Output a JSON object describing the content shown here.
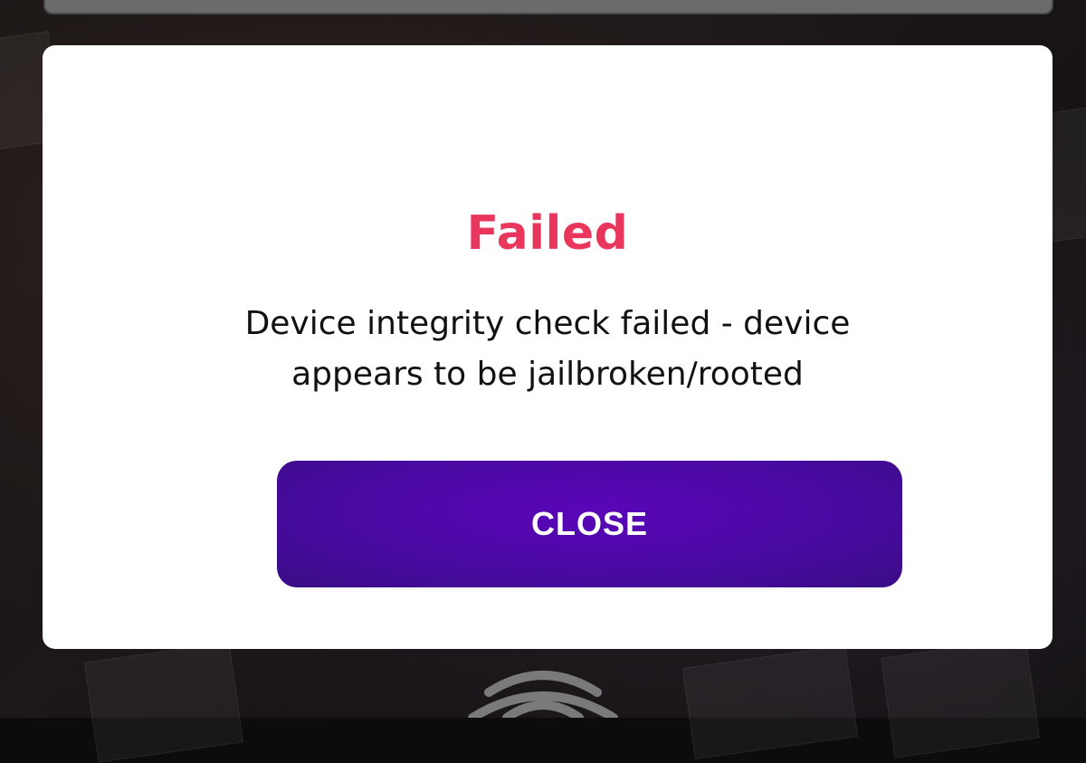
{
  "dialog": {
    "title": "Failed",
    "message": "Device integrity check failed - device appears to be jailbroken/rooted",
    "close_label": "CLOSE"
  },
  "colors": {
    "title": "#e8365d",
    "button": "#4a0aa3",
    "dialog_background": "#ffffff",
    "backdrop": "#0d0b0c"
  },
  "icons": {
    "background_icon": "fingerprint-icon"
  }
}
